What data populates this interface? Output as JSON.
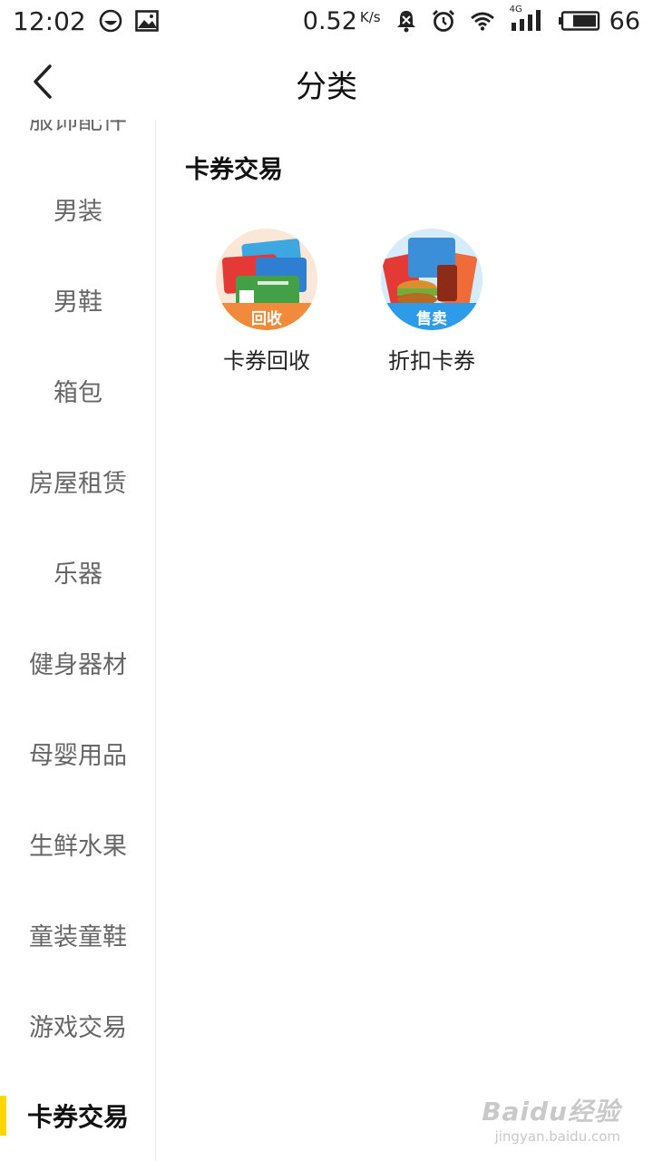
{
  "status_bar": {
    "time": "12:02",
    "net_speed": "0.52",
    "net_unit": "K/s",
    "signal_label": "4G",
    "battery": "66",
    "icons": [
      "face-icon",
      "image-icon",
      "bell-off-icon",
      "alarm-icon",
      "wifi-icon",
      "signal-icon",
      "battery-icon"
    ]
  },
  "header": {
    "title": "分类",
    "back_icon": "chevron-left-icon"
  },
  "sidebar": {
    "items": [
      {
        "label": "服饰配件",
        "active": false
      },
      {
        "label": "男装",
        "active": false
      },
      {
        "label": "男鞋",
        "active": false
      },
      {
        "label": "箱包",
        "active": false
      },
      {
        "label": "房屋租赁",
        "active": false
      },
      {
        "label": "乐器",
        "active": false
      },
      {
        "label": "健身器材",
        "active": false
      },
      {
        "label": "母婴用品",
        "active": false
      },
      {
        "label": "生鲜水果",
        "active": false
      },
      {
        "label": "童装童鞋",
        "active": false
      },
      {
        "label": "游戏交易",
        "active": false
      },
      {
        "label": "卡券交易",
        "active": true
      }
    ],
    "active_color": "#ffd600"
  },
  "content": {
    "section_title": "卡券交易",
    "items": [
      {
        "label": "卡券回收",
        "badge": "回收",
        "badge_color": "#f28a3b"
      },
      {
        "label": "折扣卡券",
        "badge": "售卖",
        "badge_color": "#2e9be8"
      }
    ]
  },
  "watermark": {
    "main": "Baidu经验",
    "sub": "jingyan.baidu.com"
  }
}
